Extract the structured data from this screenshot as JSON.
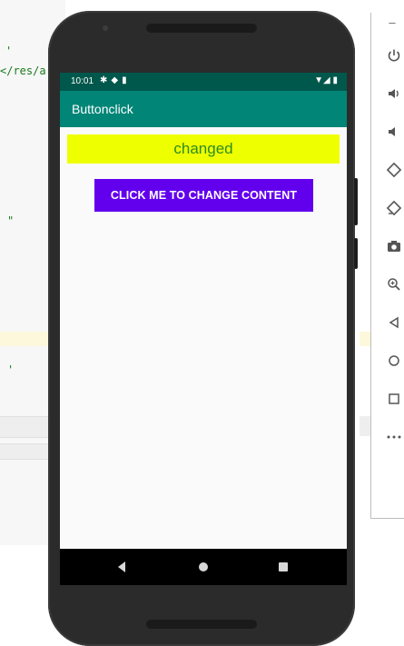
{
  "ide": {
    "line1": "'",
    "line2": "</res/a",
    "line3": "\"",
    "line4": "'"
  },
  "phone": {
    "status": {
      "time": "10:01",
      "left_icons": [
        "gear-icon",
        "shield-icon",
        "sd-card-icon"
      ],
      "right_icons": [
        "wifi-icon",
        "signal-icon",
        "battery-icon"
      ]
    },
    "app_bar": {
      "title": "Buttonclick"
    },
    "content": {
      "changed_text": "changed",
      "button_label": "CLICK ME TO CHANGE CONTENT"
    },
    "nav": {
      "buttons": [
        "back",
        "home",
        "recents"
      ]
    }
  },
  "emulator_toolbar": {
    "minimize": "–",
    "buttons": [
      "power-icon",
      "volume-up-icon",
      "volume-down-icon",
      "rotate-left-icon",
      "rotate-right-icon",
      "camera-icon",
      "zoom-icon",
      "back-icon",
      "home-icon",
      "overview-icon",
      "more-icon"
    ]
  },
  "colors": {
    "status_bar": "#00574b",
    "app_bar": "#008577",
    "changed_bg": "#eeff00",
    "changed_text": "#2e8b1e",
    "button_bg": "#6200ee"
  }
}
